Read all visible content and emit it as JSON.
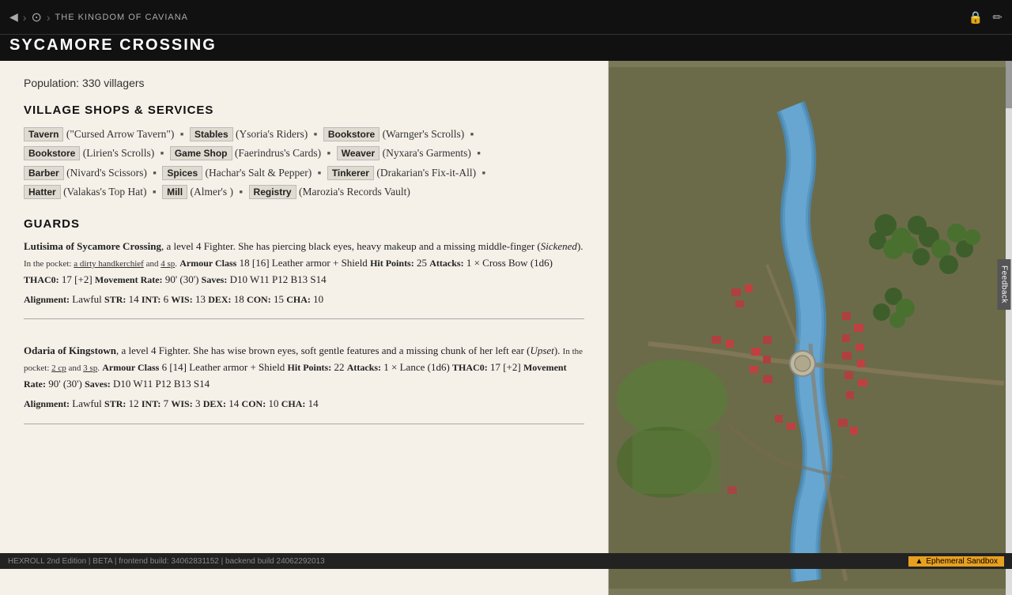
{
  "topbar": {
    "breadcrumb": "THE KINGDOM OF CAVIANA",
    "page_title": "SYCAMORE CROSSING",
    "back_icon": "◀",
    "kingdom_icon": "⊙",
    "lock_icon": "🔒",
    "pencil_icon": "✏"
  },
  "content": {
    "population": "Population: 330 villagers",
    "section_shops": "VILLAGE SHOPS & SERVICES",
    "section_guards": "GUARDS",
    "shops": [
      {
        "type": "Tavern",
        "name": "(\"Cursed Arrow Tavern\")"
      },
      {
        "type": "Stables",
        "name": "(Ysoria's Riders)"
      },
      {
        "type": "Bookstore",
        "name": "(Warnger's Scrolls)"
      },
      {
        "type": "Bookstore",
        "name": "(Lirien's Scrolls)"
      },
      {
        "type": "Game Shop",
        "name": "(Faerindrus's Cards)"
      },
      {
        "type": "Weaver",
        "name": "(Nyxara's Garments)"
      },
      {
        "type": "Barber",
        "name": "(Nivard's Scissors)"
      },
      {
        "type": "Spices",
        "name": "(Hachar's Salt & Pepper)"
      },
      {
        "type": "Tinkerer",
        "name": "(Drakarian's Fix-it-All)"
      },
      {
        "type": "Hatter",
        "name": "(Valakas's Top Hat)"
      },
      {
        "type": "Mill",
        "name": "(Almer's )"
      },
      {
        "type": "Registry",
        "name": "(Marozia's Records Vault)"
      }
    ],
    "guards": [
      {
        "name": "Lutisima of Sycamore Crossing",
        "level": "a level 4 Fighter.",
        "description": "She has piercing black eyes, heavy makeup and a missing middle-finger",
        "condition": "Sickened",
        "pocket": "In the pocket:",
        "pocket_items": "a dirty handkerchief",
        "pocket_money": "and 4 sp.",
        "ac_label": "Armour Class",
        "ac": "18 [16] Leather armor + Shield",
        "hp_label": "Hit Points:",
        "hp": "25",
        "attacks_label": "Attacks:",
        "attacks": "1 × Cross Bow (1d6)",
        "thac0_label": "THAC0:",
        "thac0": "17 [+2]",
        "mv_label": "Movement Rate:",
        "mv": "90' (30')",
        "saves_label": "Saves:",
        "saves": "D10 W11 P12 B13 S14",
        "align_label": "Alignment:",
        "align": "Lawful",
        "str_label": "STR:",
        "str": "14",
        "int_label": "INT:",
        "int": "6",
        "wis_label": "WIS:",
        "wis": "13",
        "dex_label": "DEX:",
        "dex": "18",
        "con_label": "CON:",
        "con": "15",
        "cha_label": "CHA:",
        "cha": "10"
      },
      {
        "name": "Odaria of Kingstown",
        "level": "a level 4 Fighter.",
        "description": "She has wise brown eyes, soft gentle features and a missing chunk of her left ear",
        "condition": "Upset",
        "pocket": "In the pocket:",
        "pocket_money1": "2 cp",
        "pocket_and": "and",
        "pocket_money2": "3 sp.",
        "ac_label": "Armour Class",
        "ac": "6 [14] Leather armor + Shield",
        "hp_label": "Hit Points:",
        "hp": "22",
        "attacks_label": "Attacks:",
        "attacks": "1 × Lance (1d6)",
        "thac0_label": "THAC0:",
        "thac0": "17 [+2]",
        "mv_label": "Movement Rate:",
        "mv": "90' (30')",
        "saves_label": "Saves:",
        "saves": "D10 W11 P12 B13 S14",
        "align_label": "Alignment:",
        "align": "Lawful",
        "str_label": "STR:",
        "str": "12",
        "int_label": "INT:",
        "int": "7",
        "wis_label": "WIS:",
        "wis": "3",
        "dex_label": "DEX:",
        "dex": "14",
        "con_label": "CON:",
        "con": "10",
        "cha_label": "CHA:",
        "cha": "14"
      }
    ]
  },
  "statusbar": {
    "text": "HEXROLL 2nd Edition | BETA | frontend build: 34062831152 | backend build 24062292013",
    "warning": "Ephemeral Sandbox"
  },
  "feedback": "Feedback"
}
